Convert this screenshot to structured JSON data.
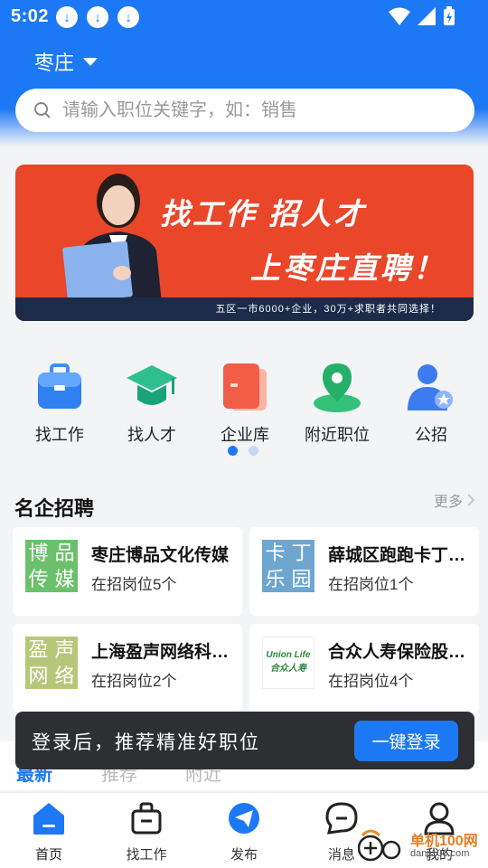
{
  "status": {
    "time": "5:02"
  },
  "header": {
    "city": "枣庄"
  },
  "search": {
    "placeholder": "请输入职位关键字，如：销售"
  },
  "banner": {
    "line1": "找工作  招人才",
    "line2": "上枣庄直聘！",
    "footer": "五区一市6000+企业，30万+求职者共同选择！"
  },
  "categories": [
    {
      "label": "找工作",
      "icon": "briefcase-icon"
    },
    {
      "label": "找人才",
      "icon": "graduation-cap-icon"
    },
    {
      "label": "企业库",
      "icon": "company-book-icon"
    },
    {
      "label": "附近职位",
      "icon": "location-pin-icon"
    },
    {
      "label": "公招",
      "icon": "person-badge-icon"
    }
  ],
  "section": {
    "title": "名企招聘",
    "more": "更多"
  },
  "companies": [
    {
      "name": "枣庄博品文化传媒",
      "positions": "在招岗位5个",
      "logo_text": [
        "博",
        "品",
        "传",
        "媒"
      ],
      "logo_color": "#6cc06c"
    },
    {
      "name": "薛城区跑跑卡丁车乐园",
      "positions": "在招岗位1个",
      "logo_text": [
        "卡",
        "丁",
        "乐",
        "园"
      ],
      "logo_color": "#6ea6cf"
    },
    {
      "name": "上海盈声网络科技有限公司",
      "positions": "在招岗位2个",
      "logo_text": [
        "盈",
        "声",
        "网",
        "络"
      ],
      "logo_color": "#b6c77a"
    },
    {
      "name": "合众人寿保险股份有限公司",
      "positions": "在招岗位4个",
      "logo_text": [
        "Union Life",
        "合众人寿"
      ],
      "logo_color": "#2c8a3c"
    }
  ],
  "tabs": [
    {
      "label": "最新",
      "active": true
    },
    {
      "label": "推荐",
      "active": false
    },
    {
      "label": "附近",
      "active": false
    }
  ],
  "toast": {
    "text": "登录后，推荐精准好职位",
    "button": "一键登录"
  },
  "nav": [
    {
      "label": "首页",
      "icon": "home-icon",
      "active": true
    },
    {
      "label": "找工作",
      "icon": "bag-icon",
      "active": false
    },
    {
      "label": "发布",
      "icon": "send-icon",
      "active": false
    },
    {
      "label": "消息",
      "icon": "message-icon",
      "active": false
    },
    {
      "label": "我的",
      "icon": "user-icon",
      "active": false
    }
  ],
  "watermark": {
    "text": "单机100网",
    "url": "danji100.com"
  },
  "colors": {
    "primary": "#1d78f5",
    "banner": "#e9462a",
    "toast": "#2d2f33"
  }
}
